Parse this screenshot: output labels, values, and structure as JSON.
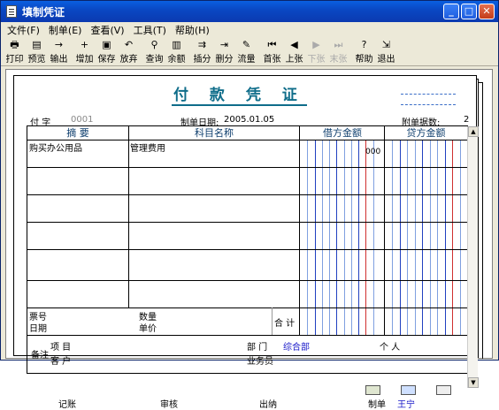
{
  "window": {
    "title": "填制凭证"
  },
  "menu": [
    "文件(F)",
    "制单(E)",
    "查看(V)",
    "工具(T)",
    "帮助(H)"
  ],
  "toolbar": [
    {
      "label": "打印",
      "icon": "print-icon",
      "glyph": "🖶",
      "enabled": true
    },
    {
      "label": "预览",
      "icon": "preview-icon",
      "glyph": "▤",
      "enabled": true
    },
    {
      "label": "输出",
      "icon": "export-icon",
      "glyph": "→",
      "enabled": true
    },
    {
      "label": "增加",
      "icon": "add-icon",
      "glyph": "+",
      "enabled": true
    },
    {
      "label": "保存",
      "icon": "save-icon",
      "glyph": "▣",
      "enabled": true
    },
    {
      "label": "放弃",
      "icon": "undo-icon",
      "glyph": "↶",
      "enabled": true
    },
    {
      "label": "查询",
      "icon": "binoculars-icon",
      "glyph": "⚲",
      "enabled": true
    },
    {
      "label": "余额",
      "icon": "balance-icon",
      "glyph": "▥",
      "enabled": true
    },
    {
      "label": "插分",
      "icon": "insert-row-icon",
      "glyph": "⇉",
      "enabled": true
    },
    {
      "label": "删分",
      "icon": "delete-row-icon",
      "glyph": "⇥",
      "enabled": true
    },
    {
      "label": "流量",
      "icon": "cashflow-icon",
      "glyph": "✎",
      "enabled": true
    },
    {
      "label": "首张",
      "icon": "first-icon",
      "glyph": "⏮",
      "enabled": true
    },
    {
      "label": "上张",
      "icon": "prev-icon",
      "glyph": "◀",
      "enabled": true
    },
    {
      "label": "下张",
      "icon": "next-icon",
      "glyph": "▶",
      "enabled": false
    },
    {
      "label": "末张",
      "icon": "last-icon",
      "glyph": "⏭",
      "enabled": false
    },
    {
      "label": "帮助",
      "icon": "help-icon",
      "glyph": "?",
      "enabled": true
    },
    {
      "label": "退出",
      "icon": "exit-icon",
      "glyph": "⇲",
      "enabled": true
    }
  ],
  "voucher": {
    "title": "付 款 凭 证",
    "type_label": "付 字",
    "number": "0001",
    "date_label": "制单日期:",
    "date": "2005.01.05",
    "attach_label": "附单据数:",
    "attach_value": "2",
    "columns": {
      "summary": "摘 要",
      "account": "科目名称",
      "debit": "借方金额",
      "credit": "贷方金额"
    },
    "rows": [
      {
        "summary": "购买办公用品",
        "account": "管理费用",
        "debit": "000",
        "credit": ""
      },
      {
        "summary": "",
        "account": "",
        "debit": "",
        "credit": ""
      },
      {
        "summary": "",
        "account": "",
        "debit": "",
        "credit": ""
      },
      {
        "summary": "",
        "account": "",
        "debit": "",
        "credit": ""
      },
      {
        "summary": "",
        "account": "",
        "debit": "",
        "credit": ""
      }
    ],
    "bill_no_label": "票号",
    "date2_label": "日期",
    "qty_label": "数量",
    "price_label": "单价",
    "total_label": "合 计",
    "remark_label": "备注",
    "project_label": "项 目",
    "customer_label": "客 户",
    "dept_label": "部 门",
    "dept_value": "综合部",
    "person_label": "个 人",
    "salesman_label": "业务员",
    "bookkeeper_label": "记账",
    "auditor_label": "审核",
    "cashier_label": "出纳",
    "maker_label": "制单",
    "maker_value": "王宁"
  },
  "colors": {
    "title": "#0f6d8a",
    "header": "#0f3f6e",
    "blue_text": "#1515c8",
    "grid_red": "#d03030",
    "grid_blue": "#2040c0"
  }
}
